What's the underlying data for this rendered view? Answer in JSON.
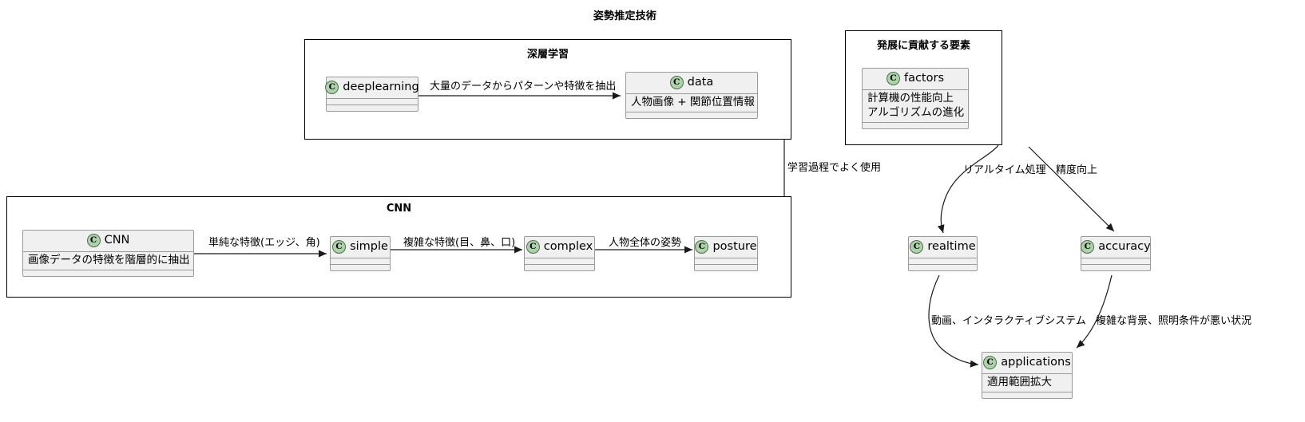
{
  "diagram": {
    "title": "姿勢推定技術"
  },
  "packages": [
    {
      "name": "deeplearning-package",
      "label": "深層学習"
    },
    {
      "name": "cnn-package",
      "label": "CNN"
    },
    {
      "name": "factors-package",
      "label": "発展に貢献する要素"
    }
  ],
  "classes": [
    {
      "name": "deeplearning",
      "title": "deeplearning",
      "icon": "class-icon",
      "icon_letter": "C",
      "attributes": [],
      "has_empty_compartments": true
    },
    {
      "name": "data",
      "title": "data",
      "icon": "class-icon",
      "icon_letter": "C",
      "attributes": [
        "人物画像 + 関節位置情報"
      ],
      "has_empty_compartments": false
    },
    {
      "name": "cnn",
      "title": "CNN",
      "icon": "class-icon",
      "icon_letter": "C",
      "attributes": [
        "画像データの特徴を階層的に抽出"
      ],
      "has_empty_compartments": false
    },
    {
      "name": "simple",
      "title": "simple",
      "icon": "class-icon",
      "icon_letter": "C",
      "attributes": [],
      "has_empty_compartments": true
    },
    {
      "name": "complex",
      "title": "complex",
      "icon": "class-icon",
      "icon_letter": "C",
      "attributes": [],
      "has_empty_compartments": true
    },
    {
      "name": "posture",
      "title": "posture",
      "icon": "class-icon",
      "icon_letter": "C",
      "attributes": [],
      "has_empty_compartments": true
    },
    {
      "name": "factors",
      "title": "factors",
      "icon": "class-icon",
      "icon_letter": "C",
      "attributes": [
        "計算機の性能向上",
        "アルゴリズムの進化"
      ],
      "has_empty_compartments": false
    },
    {
      "name": "realtime",
      "title": "realtime",
      "icon": "class-icon",
      "icon_letter": "C",
      "attributes": [],
      "has_empty_compartments": true
    },
    {
      "name": "accuracy",
      "title": "accuracy",
      "icon": "class-icon",
      "icon_letter": "C",
      "attributes": [],
      "has_empty_compartments": true
    },
    {
      "name": "applications",
      "title": "applications",
      "icon": "class-icon",
      "icon_letter": "C",
      "attributes": [
        "適用範囲拡大"
      ],
      "has_empty_compartments": false
    }
  ],
  "edges": [
    {
      "name": "deeplearning-to-data",
      "label": "大量のデータからパターンや特徴を抽出"
    },
    {
      "name": "deeplearning-to-cnn",
      "label": "学習過程でよく使用"
    },
    {
      "name": "cnn-to-simple",
      "label": "単純な特徴(エッジ、角)"
    },
    {
      "name": "simple-to-complex",
      "label": "複雑な特徴(目、鼻、口)"
    },
    {
      "name": "complex-to-posture",
      "label": "人物全体の姿勢"
    },
    {
      "name": "factors-to-realtime",
      "label": "リアルタイム処理"
    },
    {
      "name": "factors-to-accuracy",
      "label": "精度向上"
    },
    {
      "name": "realtime-to-applications",
      "label": "動画、インタラクティブシステム"
    },
    {
      "name": "accuracy-to-applications",
      "label": "複雑な背景、照明条件が悪い状況"
    }
  ],
  "colors": {
    "class_fill": "#f0f0f0",
    "class_border": "#9a9a9a",
    "icon_fill": "#add1ab",
    "icon_border": "#4c724a",
    "package_border": "#000000",
    "edge_stroke": "#1a1a1a",
    "text": "#000000"
  }
}
